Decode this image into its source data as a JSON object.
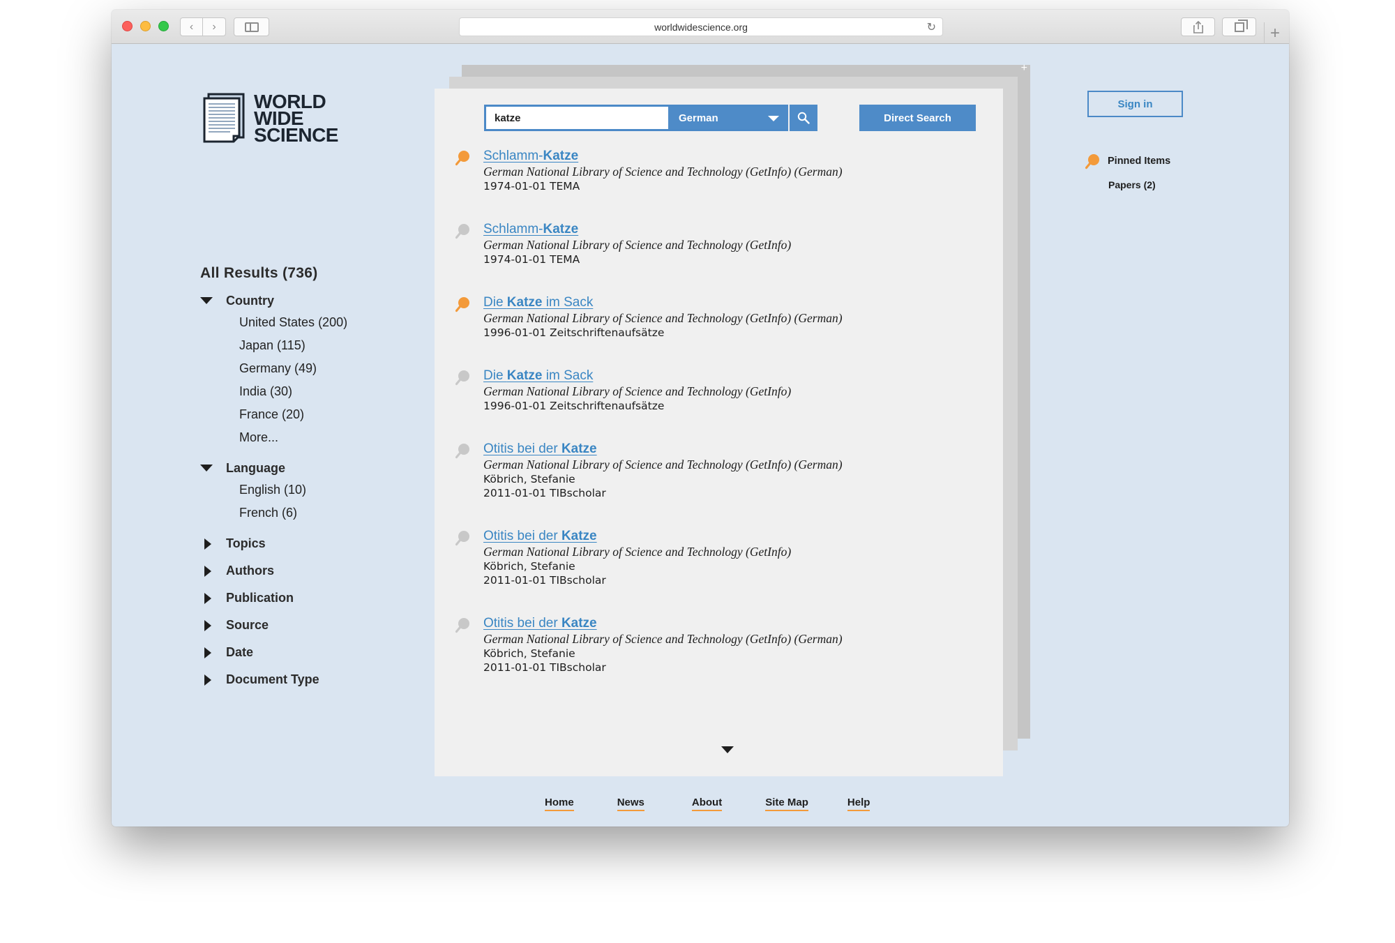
{
  "browser": {
    "url": "worldwidescience.org"
  },
  "logo": {
    "line1": "WORLD",
    "line2": "WIDE",
    "line3": "SCIENCE"
  },
  "search": {
    "query": "katze",
    "language": "German",
    "direct_search_label": "Direct Search"
  },
  "facets": {
    "title": "All Results (736)",
    "country": {
      "label": "Country",
      "items": [
        "United States (200)",
        "Japan (115)",
        "Germany (49)",
        "India (30)",
        "France (20)",
        "More..."
      ]
    },
    "language": {
      "label": "Language",
      "items": [
        "English (10)",
        "French (6)"
      ]
    },
    "collapsed": [
      "Topics",
      "Authors",
      "Publication",
      "Source",
      "Date",
      "Document Type"
    ]
  },
  "results": [
    {
      "pinned": true,
      "title_pre": "Schlamm-",
      "title_bold": "Katze",
      "title_post": "",
      "source": "German National Library of Science and Technology (GetInfo) (German)",
      "author": "",
      "date_line": "1974-01-01 TEMA"
    },
    {
      "pinned": false,
      "title_pre": "Schlamm-",
      "title_bold": "Katze",
      "title_post": "",
      "source": "German National Library of Science and Technology (GetInfo)",
      "author": "",
      "date_line": "1974-01-01 TEMA"
    },
    {
      "pinned": true,
      "title_pre": "Die ",
      "title_bold": "Katze",
      "title_post": " im Sack",
      "source": "German National Library of Science and Technology (GetInfo) (German)",
      "author": "",
      "date_line": "1996-01-01 Zeitschriftenaufsätze"
    },
    {
      "pinned": false,
      "title_pre": "Die ",
      "title_bold": "Katze",
      "title_post": " im Sack",
      "source": "German National Library of Science and Technology (GetInfo)",
      "author": "",
      "date_line": "1996-01-01 Zeitschriftenaufsätze"
    },
    {
      "pinned": false,
      "title_pre": "Otitis bei der ",
      "title_bold": "Katze",
      "title_post": "",
      "source": "German National Library of Science and Technology (GetInfo) (German)",
      "author": "Köbrich, Stefanie",
      "date_line": "2011-01-01 TIBscholar"
    },
    {
      "pinned": false,
      "title_pre": "Otitis bei der ",
      "title_bold": "Katze",
      "title_post": "",
      "source": "German National Library of Science and Technology (GetInfo)",
      "author": "Köbrich, Stefanie",
      "date_line": "2011-01-01 TIBscholar"
    },
    {
      "pinned": false,
      "title_pre": "Otitis bei der ",
      "title_bold": "Katze",
      "title_post": "",
      "source": "German National Library of Science and Technology (GetInfo) (German)",
      "author": "Köbrich, Stefanie",
      "date_line": "2011-01-01 TIBscholar"
    }
  ],
  "footer": [
    "Home",
    "News",
    "About",
    "Site Map",
    "Help"
  ],
  "account": {
    "sign_in_label": "Sign in",
    "pinned_label": "Pinned Items",
    "pinned_papers": "Papers (2)"
  },
  "colors": {
    "page_bg": "#dae5f1",
    "accent_blue": "#4e8bc8",
    "link_blue": "#3a86c3",
    "pin_orange": "#f39a3a",
    "pin_grey": "#c8c8c8"
  }
}
